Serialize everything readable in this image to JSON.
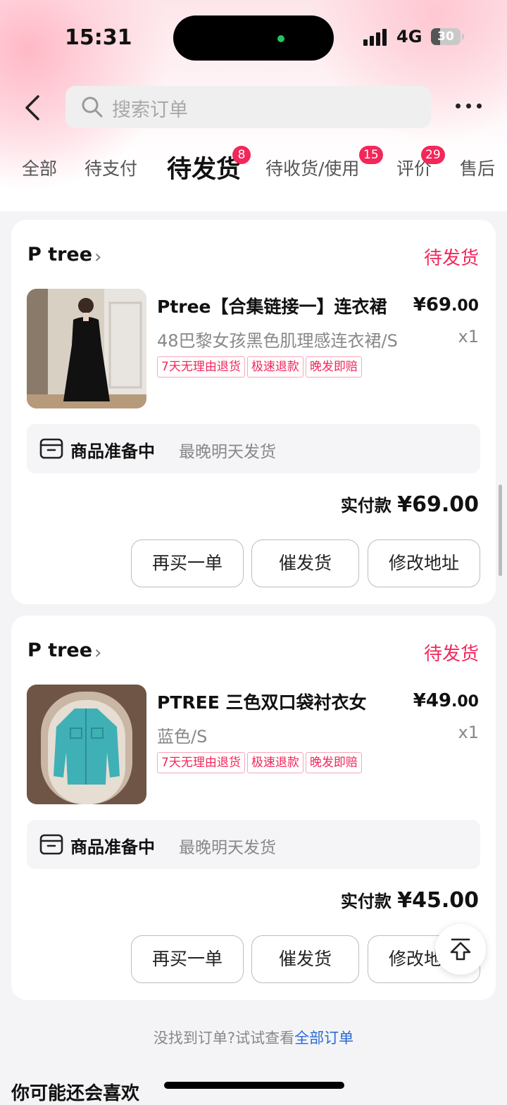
{
  "status_bar": {
    "time": "15:31",
    "network": "4G",
    "battery": "30"
  },
  "search": {
    "placeholder": "搜索订单"
  },
  "tabs": [
    {
      "label": "全部"
    },
    {
      "label": "待支付"
    },
    {
      "label": "待发货",
      "badge": "8",
      "active": true
    },
    {
      "label": "待收货/使用",
      "badge": "15"
    },
    {
      "label": "评价",
      "badge": "29"
    },
    {
      "label": "售后"
    }
  ],
  "orders": [
    {
      "shop": "P tree",
      "status": "待发货",
      "title": "Ptree【合集链接一】连衣裙",
      "price_int": "¥69",
      "price_dec": ".00",
      "spec": "48巴黎女孩黑色肌理感连衣裙/S",
      "qty": "x1",
      "tags": [
        "7天无理由退货",
        "极速退款",
        "晚发即赔"
      ],
      "ship_title": "商品准备中",
      "ship_note": "最晚明天发货",
      "paid_label": "实付款",
      "paid_amount": "¥69.00",
      "buttons": [
        "再买一单",
        "催发货",
        "修改地址"
      ]
    },
    {
      "shop": "P tree",
      "status": "待发货",
      "title": "PTREE 三色双口袋衬衣女",
      "price_int": "¥49",
      "price_dec": ".00",
      "spec": "蓝色/S",
      "qty": "x1",
      "tags": [
        "7天无理由退货",
        "极速退款",
        "晚发即赔"
      ],
      "ship_title": "商品准备中",
      "ship_note": "最晚明天发货",
      "paid_label": "实付款",
      "paid_amount": "¥45.00",
      "buttons": [
        "再买一单",
        "催发货",
        "修改地址"
      ]
    }
  ],
  "footer": {
    "text": "没找到订单?试试查看",
    "link": "全部订单"
  },
  "recommend": {
    "title": "你可能还会喜欢"
  },
  "colors": {
    "accent": "#f2275a",
    "link": "#2a68d6"
  },
  "icons": [
    "back-arrow-icon",
    "search-icon",
    "more-icon",
    "chevron-right-icon",
    "package-icon",
    "back-to-top-icon"
  ]
}
